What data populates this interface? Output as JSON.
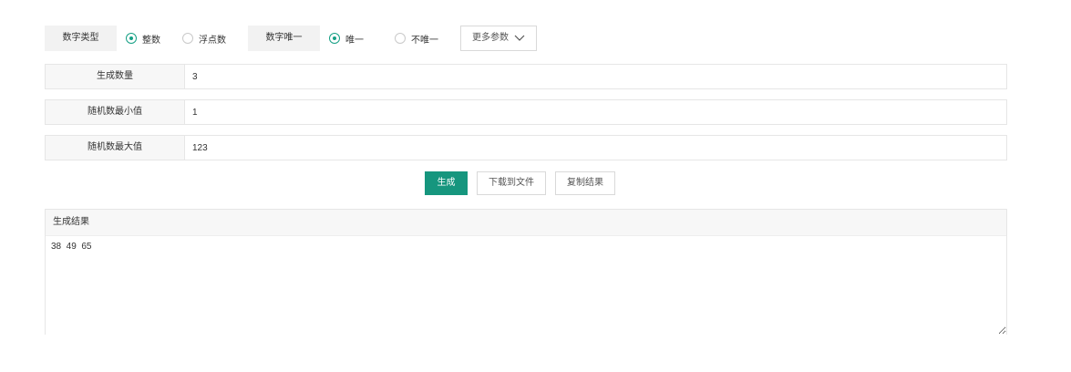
{
  "options": {
    "number_type_label": "数字类型",
    "integer_label": "整数",
    "float_label": "浮点数",
    "unique_label": "数字唯一",
    "unique_yes_label": "唯一",
    "unique_no_label": "不唯一",
    "more_params_label": "更多参数",
    "number_type_selected": "整数",
    "unique_selected": "唯一"
  },
  "fields": {
    "count": {
      "label": "生成数量",
      "value": "3"
    },
    "min": {
      "label": "随机数最小值",
      "value": "1"
    },
    "max": {
      "label": "随机数最大值",
      "value": "123"
    }
  },
  "buttons": {
    "generate": "生成",
    "download": "下载到文件",
    "copy": "复制结果"
  },
  "result": {
    "title": "生成结果",
    "value": "38  49  65"
  },
  "colors": {
    "accent": "#16967e",
    "radio_checked": "#16a085"
  },
  "icons": {
    "more_params": "chevron-down-icon"
  }
}
